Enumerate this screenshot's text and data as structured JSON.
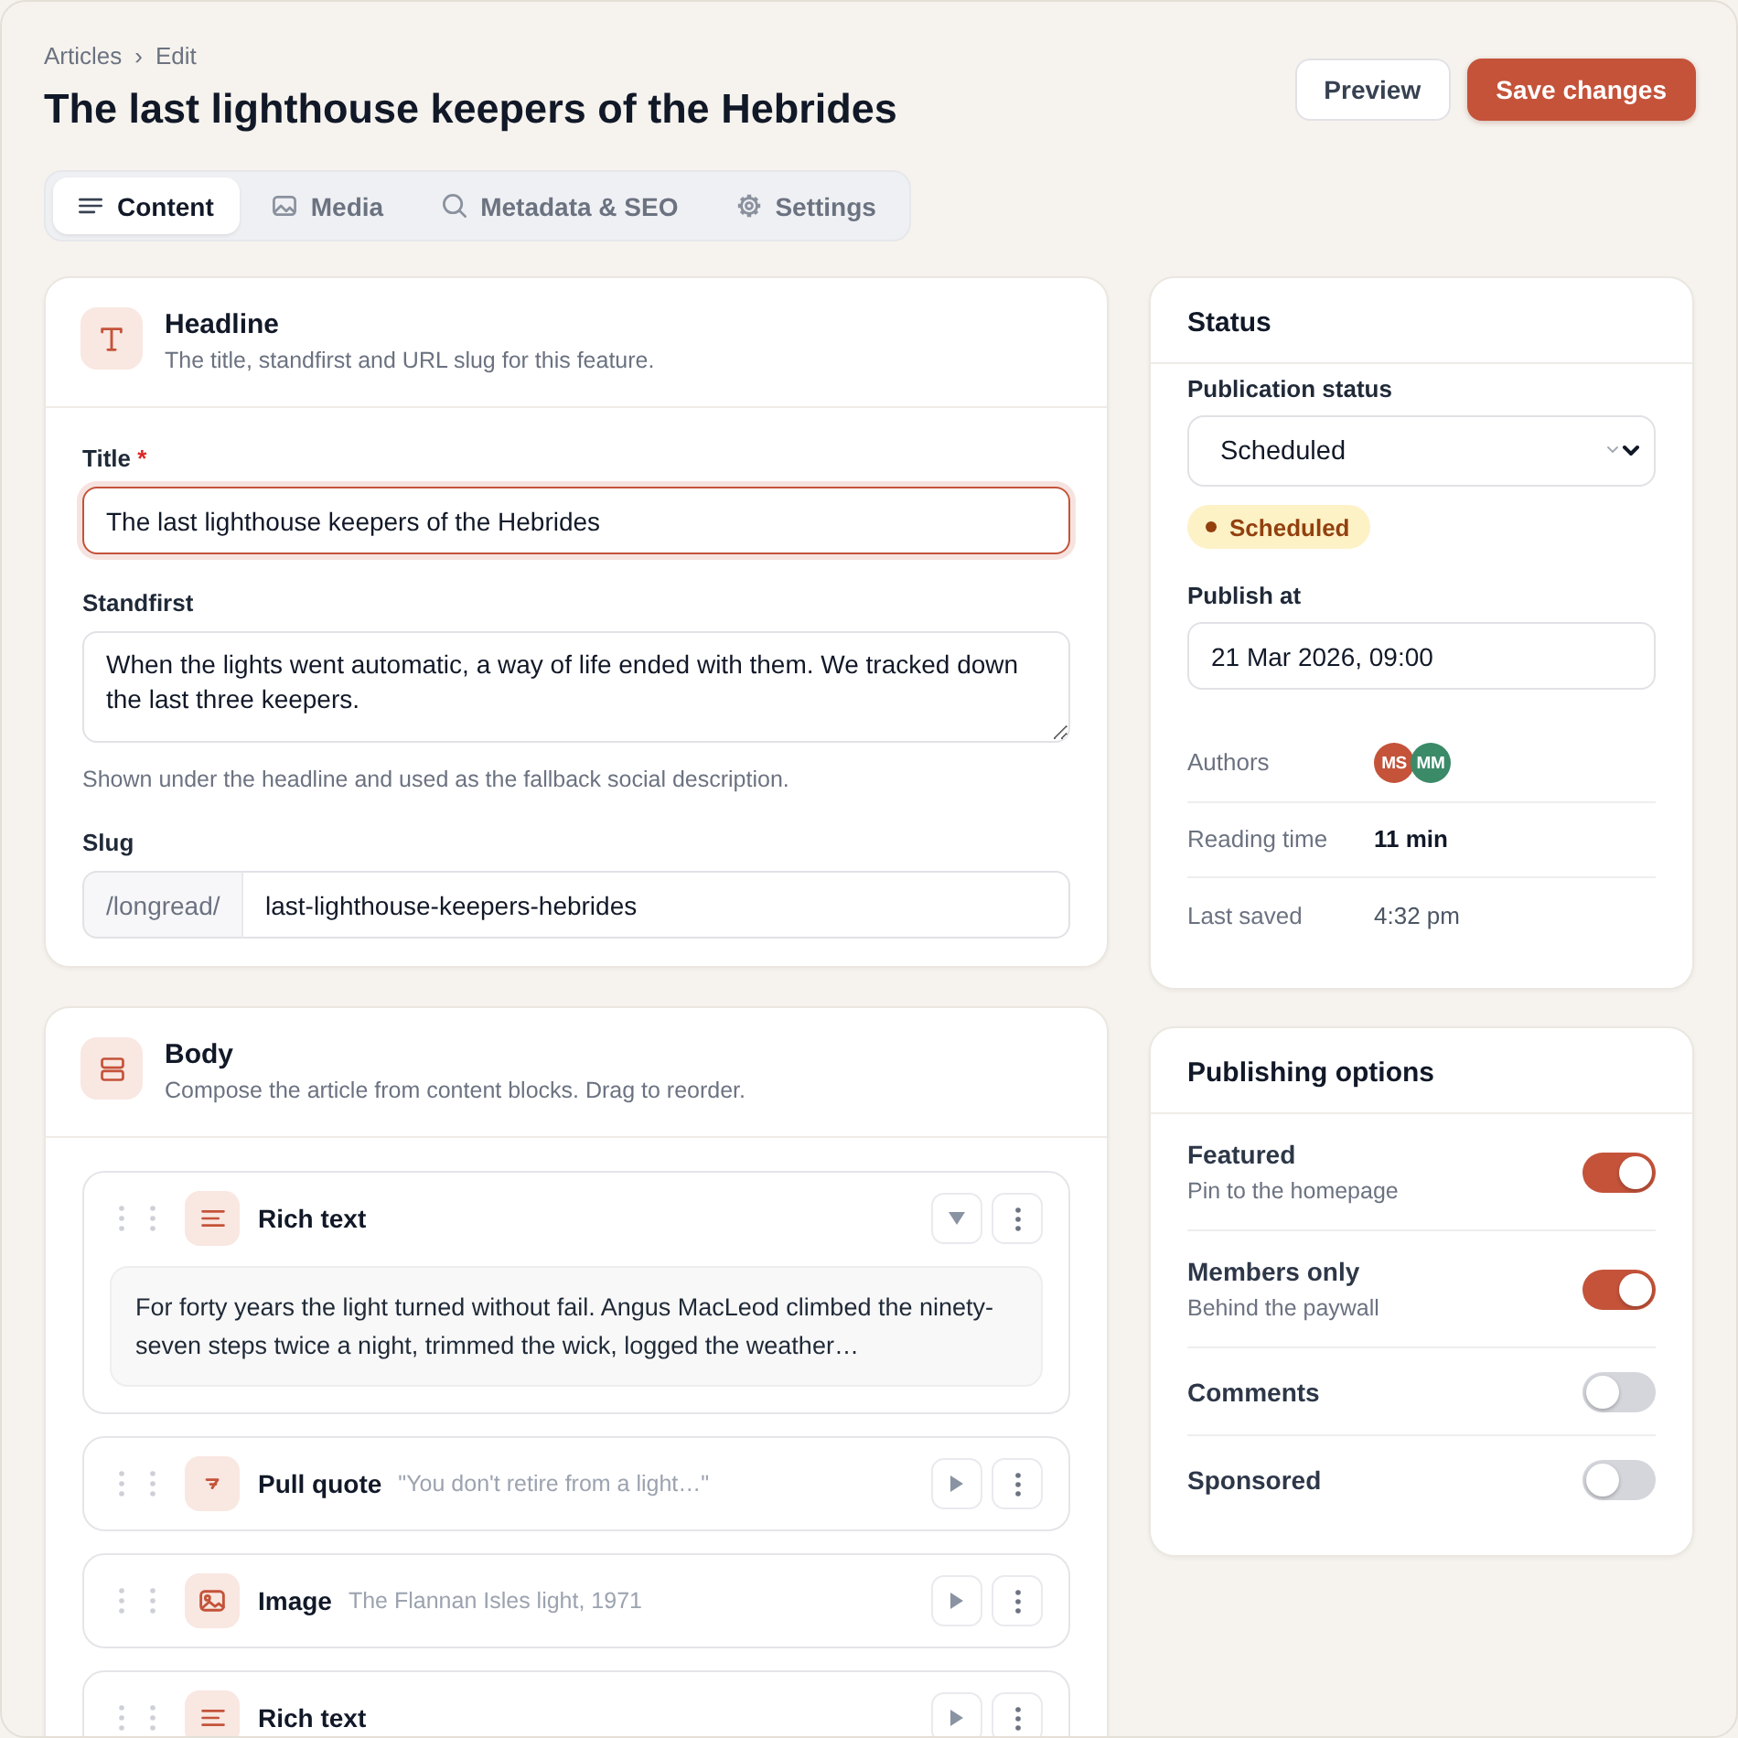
{
  "header": {
    "breadcrumb": {
      "items": [
        "Articles",
        "Edit"
      ],
      "separator": "›"
    },
    "title": "The last lighthouse keepers of the Hebrides",
    "actions": [
      {
        "kind": "secondary",
        "label": "Preview"
      },
      {
        "kind": "primary",
        "label": "Save changes"
      }
    ]
  },
  "tabs": [
    {
      "label": "Content",
      "selected": true
    },
    {
      "label": "Media",
      "selected": false
    },
    {
      "label": "Metadata & SEO",
      "selected": false
    },
    {
      "label": "Settings",
      "selected": false
    }
  ],
  "headline": {
    "title": "Headline",
    "subtitle": "The title, standfirst and URL slug for this feature.",
    "fields": [
      {
        "kind": "text",
        "label": "Title",
        "required_mark": "*",
        "value": "The last lighthouse keepers of the Hebrides",
        "focused": true
      },
      {
        "kind": "textarea",
        "label": "Standfirst",
        "value": "When the lights went automatic, a way of life ended with them. We tracked down the last three keepers.",
        "hint": "Shown under the headline and used as the fallback social description.",
        "focused": false
      },
      {
        "kind": "prefixed",
        "label": "Slug",
        "prefix": "/longread/",
        "value": "last-lighthouse-keepers-hebrides",
        "focused": false
      }
    ]
  },
  "body": {
    "title": "Body",
    "subtitle": "Compose the article from content blocks. Drag to reorder.",
    "blocks": [
      {
        "kind": "rich_text",
        "label": "Rich text",
        "expanded": true,
        "preview": "For forty years the light turned without fail. Angus MacLeod climbed the ninety-seven steps twice a night, trimmed the wick, logged the weather…"
      },
      {
        "kind": "pull_quote",
        "label": "Pull quote",
        "summary": "\"You don't retire from a light…\"",
        "expanded": false
      },
      {
        "kind": "image",
        "label": "Image",
        "summary": "The Flannan Isles light, 1971",
        "expanded": false
      },
      {
        "kind": "rich_text",
        "label": "Rich text",
        "expanded": false
      }
    ]
  },
  "status": {
    "title": "Status",
    "publication_status": {
      "label": "Publication status",
      "value": "Scheduled"
    },
    "badge": {
      "label": "Scheduled"
    },
    "publish_at": {
      "label": "Publish at",
      "value": "21 Mar 2026, 09:00"
    },
    "details": [
      {
        "kind": "avatars",
        "label": "Authors",
        "avatars": [
          {
            "initials": "MS",
            "color": "#c4533a"
          },
          {
            "initials": "MM",
            "color": "#3b8a68"
          }
        ]
      },
      {
        "kind": "text",
        "label": "Reading time",
        "value": "11 min",
        "emphasis": true
      },
      {
        "kind": "text",
        "label": "Last saved",
        "value": "4:32 pm",
        "emphasis": false
      }
    ]
  },
  "publishing_options": {
    "title": "Publishing options",
    "options": [
      {
        "label": "Featured",
        "description": "Pin to the homepage",
        "on": true
      },
      {
        "label": "Members only",
        "description": "Behind the paywall",
        "on": true
      },
      {
        "label": "Comments",
        "on": false
      },
      {
        "label": "Sponsored",
        "on": false
      }
    ]
  }
}
